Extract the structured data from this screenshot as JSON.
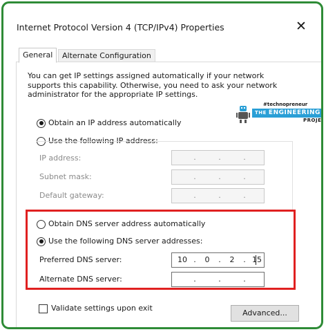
{
  "window": {
    "title": "Internet Protocol Version 4 (TCP/IPv4) Properties",
    "close_glyph": "✕"
  },
  "tabs": [
    {
      "label": "General",
      "selected": true
    },
    {
      "label": "Alternate Configuration",
      "selected": false
    }
  ],
  "description": "You can get IP settings assigned automatically if your network supports this capability. Otherwise, you need to ask your network administrator for the appropriate IP settings.",
  "ip_section": {
    "auto_label": "Obtain an IP address automatically",
    "auto_selected": true,
    "manual_label": "Use the following IP address:",
    "manual_selected": false,
    "fields": [
      {
        "label": "IP address:",
        "octets": [
          "",
          "",
          "",
          ""
        ]
      },
      {
        "label": "Subnet mask:",
        "octets": [
          "",
          "",
          "",
          ""
        ]
      },
      {
        "label": "Default gateway:",
        "octets": [
          "",
          "",
          "",
          ""
        ]
      }
    ]
  },
  "dns_section": {
    "auto_label": "Obtain DNS server address automatically",
    "auto_selected": false,
    "manual_label": "Use the following DNS server addresses:",
    "manual_selected": true,
    "fields": [
      {
        "label": "Preferred DNS server:",
        "octets": [
          "10",
          "0",
          "2",
          "15"
        ]
      },
      {
        "label": "Alternate DNS server:",
        "octets": [
          "",
          "",
          "",
          ""
        ]
      }
    ],
    "highlight_color": "#e02020"
  },
  "validate": {
    "label": "Validate settings upon exit",
    "checked": false
  },
  "advanced_button": {
    "label": "Advanced..."
  },
  "watermark": {
    "handle": "#technopreneur",
    "the": "THE",
    "name": "ENGINEERING",
    "sub": "PROJECTS",
    "band_color": "#2a9fd6"
  },
  "colors": {
    "frame_border": "#2e8b36"
  }
}
